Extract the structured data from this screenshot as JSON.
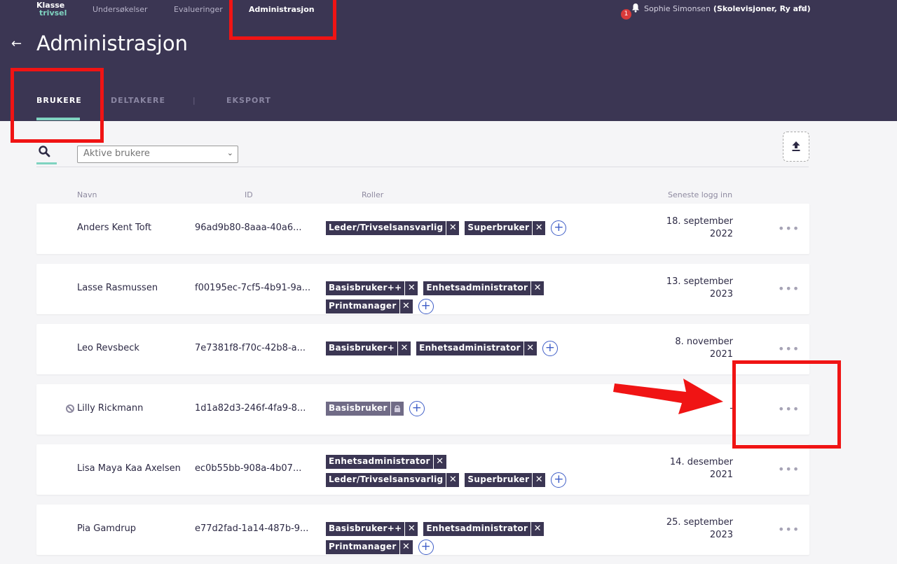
{
  "nav": {
    "logo_top": "Klasse",
    "logo_bottom": "trivsel",
    "items": [
      "Undersøkelser",
      "Evalueringer",
      "Administrasjon"
    ],
    "notification_count": "1",
    "user_name": "Sophie Simonsen",
    "user_org": "(Skolevisjoner, Ry afd)",
    "user_chevron": ">"
  },
  "page": {
    "back_icon": "←",
    "title": "Administrasjon",
    "tabs": [
      "BRUKERE",
      "DELTAKERE",
      "EKSPORT"
    ],
    "tab_separator": "|"
  },
  "filter": {
    "value": "Aktive brukere",
    "chevron": "⌄"
  },
  "columns": [
    "Navn",
    "ID",
    "Roller",
    "Seneste logg inn"
  ],
  "rows": [
    {
      "name": "Anders Kent Toft",
      "id": "96ad9b80-8aaa-40a6...",
      "roles": [
        "Leder/Trivselsansvarlig",
        "Superbruker"
      ],
      "last_line1": "18. september",
      "last_line2": "2022"
    },
    {
      "name": "Lasse Rasmussen",
      "id": "f00195ec-7cf5-4b91-9a...",
      "roles": [
        "Basisbruker++",
        "Enhetsadministrator",
        "Printmanager"
      ],
      "last_line1": "13. september",
      "last_line2": "2023"
    },
    {
      "name": "Leo Revsbeck",
      "id": "7e7381f8-f70c-42b8-a...",
      "roles": [
        "Basisbruker+",
        "Enhetsadministrator"
      ],
      "last_line1": "8. november",
      "last_line2": "2021"
    },
    {
      "name": "Lilly Rickmann",
      "id": "1d1a82d3-246f-4fa9-8...",
      "roles": [
        "Basisbruker"
      ],
      "last_line1": "-",
      "last_line2": ""
    },
    {
      "name": "Lisa Maya Kaa Axelsen",
      "id": "ec0b55bb-908a-4b07...",
      "roles": [
        "Enhetsadministrator",
        "Leder/Trivselsansvarlig",
        "Superbruker"
      ],
      "last_line1": "14. desember",
      "last_line2": "2021"
    },
    {
      "name": "Pia Gamdrup",
      "id": "e77d2fad-1a14-487b-9...",
      "roles": [
        "Basisbruker++",
        "Enhetsadministrator",
        "Printmanager"
      ],
      "last_line1": "25. september",
      "last_line2": "2023"
    }
  ],
  "symbols": {
    "remove": "✕",
    "add": "+",
    "more": "•••"
  },
  "colors": {
    "header_bg": "#3b3653",
    "accent": "#7fd3c0",
    "role_bg": "#3b3653",
    "role_disabled_bg": "#706b86",
    "add_button": "#3f5ec7",
    "annotation_red": "#f01414",
    "notification_badge": "#d83a3a"
  }
}
